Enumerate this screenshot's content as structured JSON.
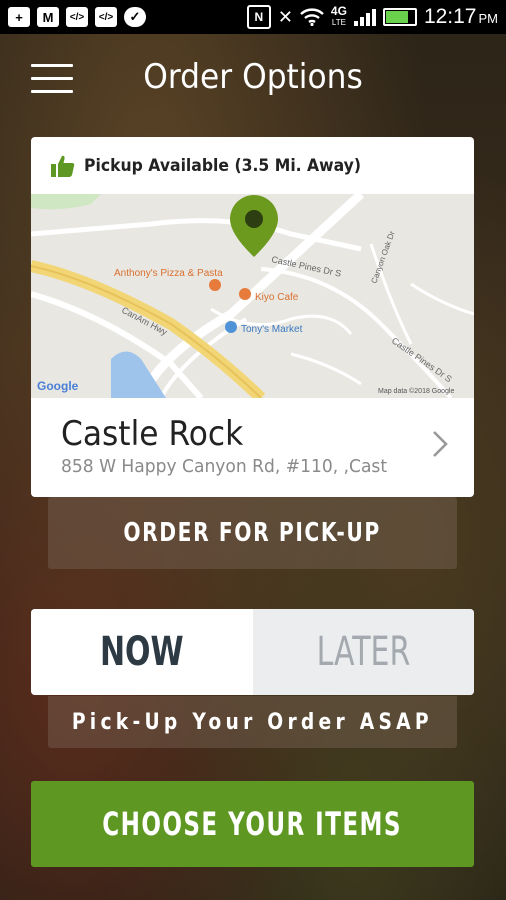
{
  "status_bar": {
    "time": "12:17",
    "ampm": "PM",
    "network": "4G",
    "network_sub": "LTE",
    "icons": [
      "add-icon",
      "gmail-icon",
      "code-icon",
      "code-icon",
      "chat-icon",
      "nfc-icon",
      "mute-icon",
      "wifi-icon",
      "signal-icon",
      "battery-icon"
    ]
  },
  "header": {
    "title": "Order Options"
  },
  "card": {
    "pickup_text": "Pickup Available (3.5 Mi. Away)",
    "map": {
      "labels": {
        "pizza": "Anthony's Pizza & Pasta",
        "cafe": "Kiyo Cafe",
        "market": "Tony's Market",
        "hwy": "CanAm Hwy",
        "castle1": "Castle Pines Dr S",
        "castle2": "Castle Pines Dr S",
        "canyon": "Canyon Oak Dr",
        "google": "Google",
        "mapdata": "Map data ©2018 Google"
      }
    },
    "location": {
      "name": "Castle Rock",
      "address": "858 W Happy Canyon Rd, #110, ,Cast..."
    }
  },
  "buttons": {
    "order_pickup": "ORDER FOR PICK-UP",
    "now": "NOW",
    "later": "LATER",
    "asap": "Pick-Up Your Order ASAP",
    "choose": "CHOOSE YOUR ITEMS"
  },
  "colors": {
    "accent_green": "#5e9823",
    "pin_green": "#6c9a1e"
  }
}
